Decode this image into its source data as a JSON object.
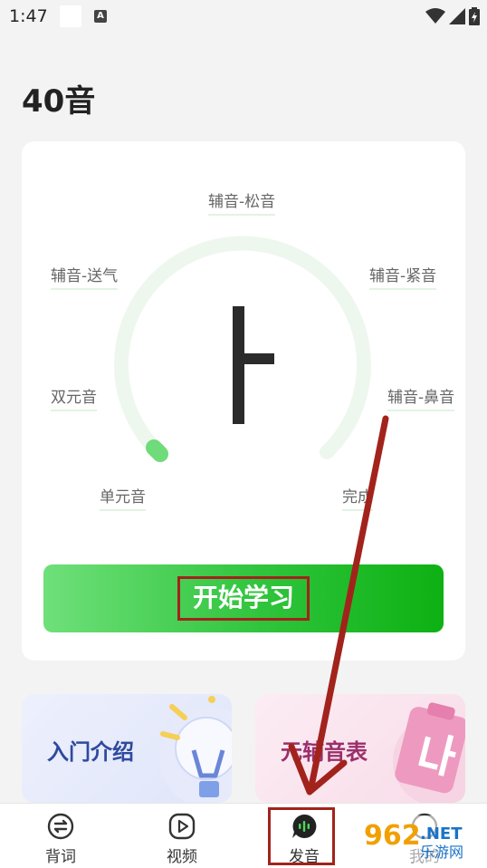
{
  "status_bar": {
    "time": "1:47",
    "notif_letter": "A"
  },
  "page": {
    "title": "40音"
  },
  "gauge": {
    "labels": {
      "relaxed": "辅音-松音",
      "aspirated": "辅音-送气",
      "tense": "辅音-紧音",
      "diphthong": "双元音",
      "nasal": "辅音-鼻音",
      "monophthong": "单元音",
      "complete": "完成"
    },
    "progress_fraction": 0.02,
    "center_letter": "ㅏ"
  },
  "start_button": {
    "label": "开始学习"
  },
  "feature_cards": {
    "intro": {
      "title": "入门介绍"
    },
    "table": {
      "title": "元辅音表"
    }
  },
  "bottom_nav": {
    "items": [
      {
        "label": "背词",
        "icon": "swap-arrows-icon"
      },
      {
        "label": "视频",
        "icon": "play-circle-icon"
      },
      {
        "label": "发音",
        "icon": "voice-bubble-icon",
        "active": true
      },
      {
        "label": "我的",
        "icon": "profile-icon"
      }
    ]
  },
  "watermark": {
    "text": "962",
    "subtext": "乐游网",
    "suffix": ".NET"
  },
  "colors": {
    "accent": "#2fc43c",
    "annotation": "#a2231c",
    "track": "#eef7ee"
  }
}
